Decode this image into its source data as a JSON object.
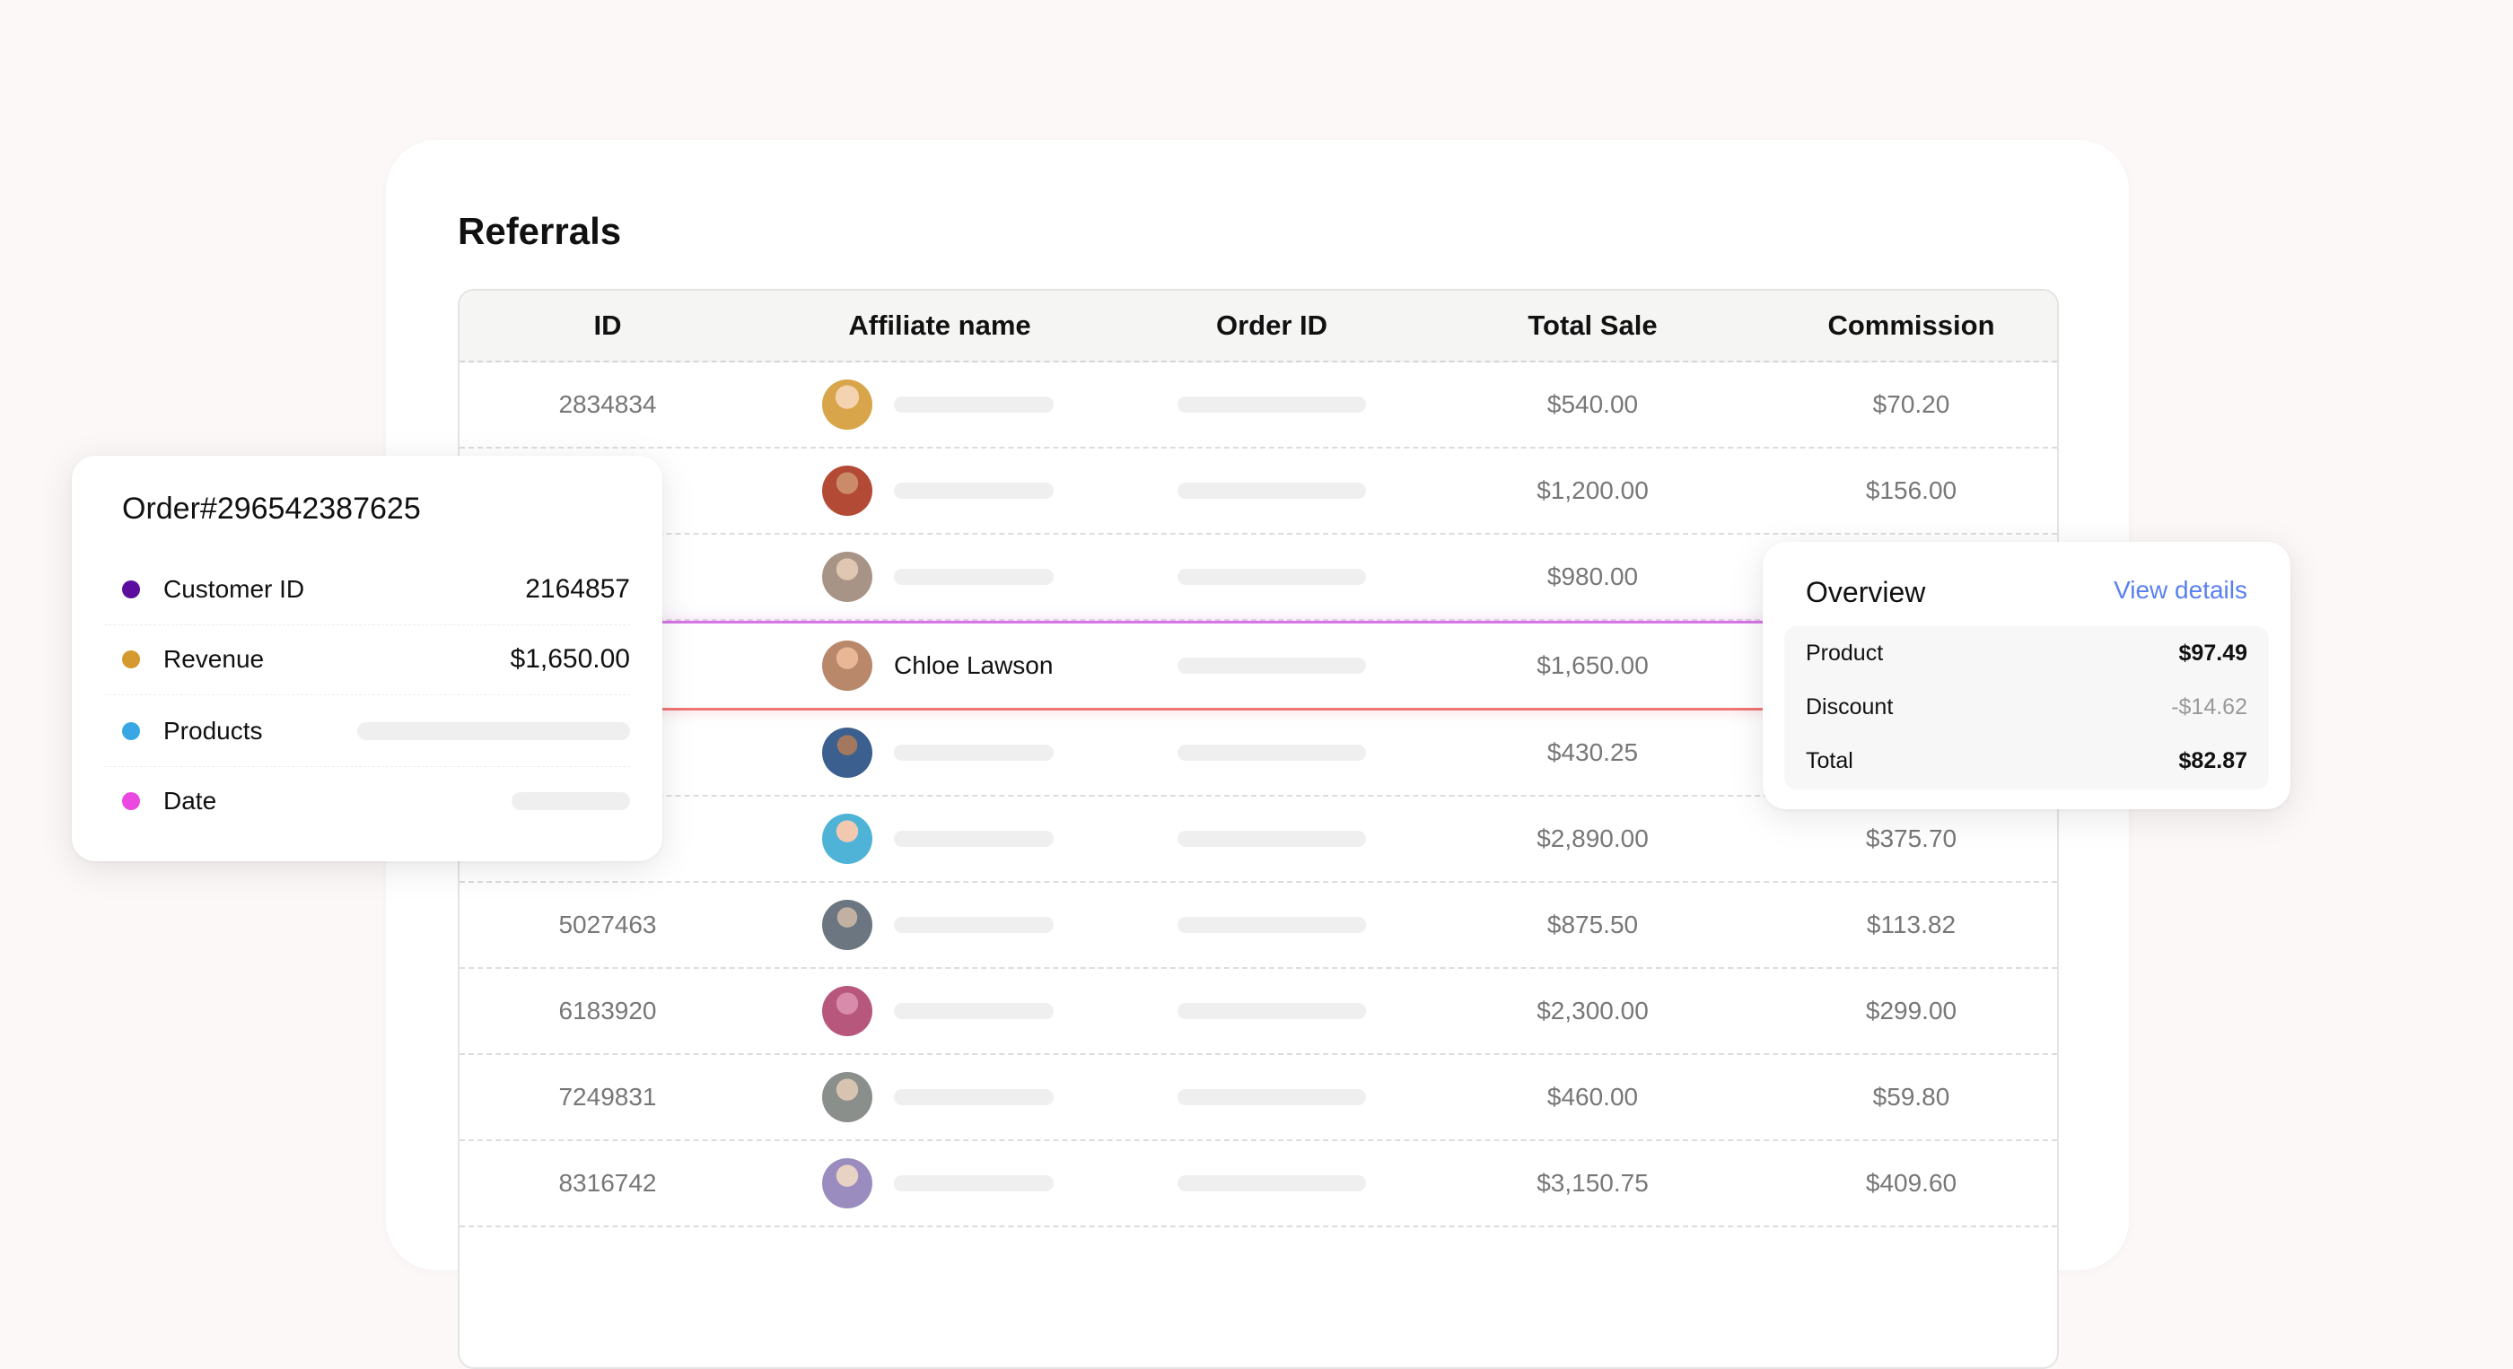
{
  "main": {
    "title": "Referrals"
  },
  "table": {
    "headers": {
      "id": "ID",
      "affiliate": "Affiliate name",
      "order": "Order ID",
      "sale": "Total Sale",
      "commission": "Commission"
    },
    "rows": [
      {
        "id": "2834834",
        "affiliate": "",
        "sale": "$540.00",
        "commission": "$70.20",
        "avatar_color": "#d9a54a"
      },
      {
        "id": "",
        "affiliate": "",
        "sale": "$1,200.00",
        "commission": "$156.00",
        "avatar_color": "#b34a35"
      },
      {
        "id": "",
        "affiliate": "",
        "sale": "$980.00",
        "commission": "",
        "avatar_color": "#a89486"
      },
      {
        "id": "",
        "affiliate": "Chloe Lawson",
        "sale": "$1,650.00",
        "commission": "",
        "avatar_color": "#b9876a"
      },
      {
        "id": "",
        "affiliate": "",
        "sale": "$430.25",
        "commission": "",
        "avatar_color": "#3b5f8e"
      },
      {
        "id": "",
        "affiliate": "",
        "sale": "$2,890.00",
        "commission": "$375.70",
        "avatar_color": "#4fb3d7"
      },
      {
        "id": "5027463",
        "affiliate": "",
        "sale": "$875.50",
        "commission": "$113.82",
        "avatar_color": "#6c7680"
      },
      {
        "id": "6183920",
        "affiliate": "",
        "sale": "$2,300.00",
        "commission": "$299.00",
        "avatar_color": "#b6577b"
      },
      {
        "id": "7249831",
        "affiliate": "",
        "sale": "$460.00",
        "commission": "$59.80",
        "avatar_color": "#8a8f8b"
      },
      {
        "id": "8316742",
        "affiliate": "",
        "sale": "$3,150.75",
        "commission": "$409.60",
        "avatar_color": "#9b8cbf"
      }
    ]
  },
  "order_popup": {
    "title": "Order#296542387625",
    "rows": [
      {
        "label": "Customer ID",
        "value": "2164857",
        "color": "#5b0d9e"
      },
      {
        "label": "Revenue",
        "value": "$1,650.00",
        "color": "#d49a2e"
      },
      {
        "label": "Products",
        "value": "",
        "color": "#3aa7e5"
      },
      {
        "label": "Date",
        "value": "",
        "color": "#ea48e1"
      }
    ]
  },
  "overview_popup": {
    "title": "Overview",
    "link": "View details",
    "rows": [
      {
        "label": "Product",
        "value": "$97.49"
      },
      {
        "label": "Discount",
        "value": "-$14.62"
      },
      {
        "label": "Total",
        "value": "$82.87"
      }
    ]
  },
  "colors": {
    "accent_link": "#5a7ff0",
    "highlight_top": "#d774e8",
    "highlight_bottom": "#f07575"
  }
}
